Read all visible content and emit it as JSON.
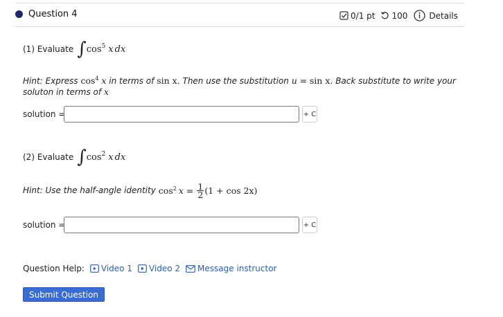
{
  "header": {
    "question_title": "Question 4",
    "score": "0/1 pt",
    "attempts": "100",
    "details_label": "Details",
    "icons": [
      "checkbox-icon",
      "retry-icon",
      "info-icon"
    ]
  },
  "part1": {
    "label": "(1) Evaluate",
    "integrand_func": "cos",
    "integrand_exp": "5",
    "integrand_var": "x",
    "integrand_dx": "dx",
    "hint_prefix": "Hint: Express",
    "hint_cos": "cos",
    "hint_exp": "4",
    "hint_var": "x",
    "hint_mid": "in terms of",
    "hint_sin": "sin x.",
    "hint_sub": "Then use the substitution",
    "hint_u": "u",
    "hint_eq": "=",
    "hint_sinx2": "sin x.",
    "hint_back": "Back substitute to write your",
    "hint_line2": "soluton in terms of",
    "hint_x": "x",
    "solution_label": "solution =",
    "solution_value": "",
    "plus_c": "+ C"
  },
  "part2": {
    "label": "(2) Evaluate",
    "integrand_func": "cos",
    "integrand_exp": "2",
    "integrand_var": "x",
    "integrand_dx": "dx",
    "hint_prefix": "Hint: Use the half-angle identity",
    "hint_cos": "cos",
    "hint_exp": "2",
    "hint_var": "x",
    "hint_eq": "=",
    "frac_num": "1",
    "frac_den": "2",
    "hint_rest": "(1 + cos 2x)",
    "solution_label": "solution =",
    "solution_value": "",
    "plus_c": "+ C"
  },
  "help": {
    "label": "Question Help:",
    "video1": "Video 1",
    "video2": "Video 2",
    "message": "Message instructor"
  },
  "submit_label": "Submit Question",
  "colors": {
    "accent": "#3a6cd6",
    "link": "#2a5fb8",
    "dot": "#1a2a6c"
  }
}
